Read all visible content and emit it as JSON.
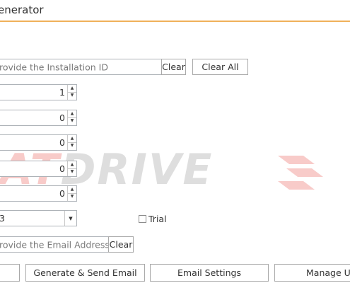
{
  "window": {
    "title": "enerator"
  },
  "installation": {
    "placeholder": "rovide the Installation ID",
    "clear_label": "Clear",
    "clear_all_label": "Clear All"
  },
  "spinners": [
    {
      "value": "1"
    },
    {
      "value": "0"
    },
    {
      "value": "0"
    },
    {
      "value": "0"
    },
    {
      "value": "0"
    }
  ],
  "dropdown": {
    "value": "3"
  },
  "trial": {
    "label": "Trial",
    "checked": false
  },
  "email": {
    "placeholder": "rovide the Email Address",
    "clear_label": "Clear"
  },
  "actions": {
    "generate_send_label": "Generate & Send Email",
    "email_settings_label": "Email Settings",
    "manage_label": "Manage Us"
  },
  "watermark": {
    "part1": "AT",
    "part2": "DRIVE"
  }
}
